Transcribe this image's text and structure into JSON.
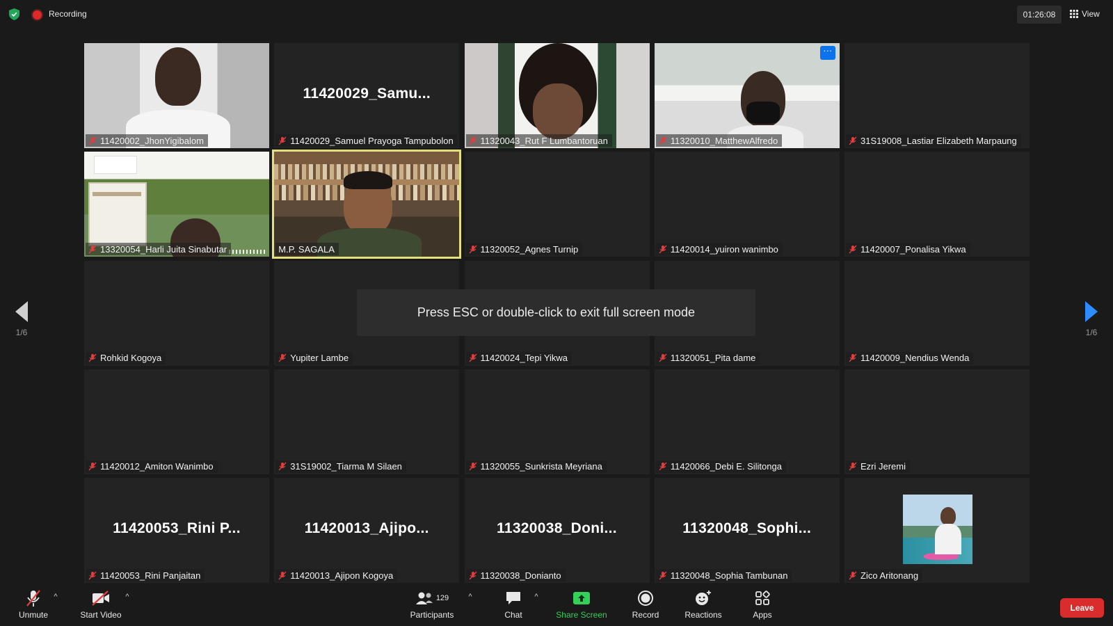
{
  "topbar": {
    "recording_label": "Recording",
    "timer": "01:26:08",
    "view_label": "View"
  },
  "colors": {
    "background": "#1a1a1a",
    "tile": "#232323",
    "active_speaker_border": "#e4e07a",
    "share_green": "#34d058",
    "leave_red": "#d92d2d",
    "accent_blue": "#2d8cff"
  },
  "tiles": [
    {
      "name": "11420002_JhonYigibalom",
      "big": "",
      "video": true
    },
    {
      "name": "11420029_Samuel Prayoga Tampubolon",
      "big": "11420029_Samu...",
      "video": false
    },
    {
      "name": "11320043_Rut F Lumbantoruan",
      "big": "",
      "video": true
    },
    {
      "name": "11320010_MatthewAlfredo",
      "big": "",
      "video": true,
      "more_button": "···"
    },
    {
      "name": "31S19008_Lastiar Elizabeth Marpaung",
      "big": "",
      "video": false
    },
    {
      "name": "13320054_Harli Juita Sinabutar",
      "big": "",
      "video": true
    },
    {
      "name": "M.P. SAGALA",
      "big": "",
      "video": true,
      "active_speaker": true
    },
    {
      "name": "11320052_Agnes Turnip",
      "big": "",
      "video": false
    },
    {
      "name": "11420014_yuiron wanimbo",
      "big": "",
      "video": false
    },
    {
      "name": "11420007_Ponalisa Yikwa",
      "big": "",
      "video": false
    },
    {
      "name": "Rohkid Kogoya",
      "big": "",
      "video": false
    },
    {
      "name": "Yupiter Lambe",
      "big": "",
      "video": false
    },
    {
      "name": "11420024_Tepi Yikwa",
      "big": "",
      "video": false
    },
    {
      "name": "11320051_Pita dame",
      "big": "",
      "video": false
    },
    {
      "name": "11420009_Nendius Wenda",
      "big": "",
      "video": false
    },
    {
      "name": "11420012_Amiton Wanimbo",
      "big": "",
      "video": false
    },
    {
      "name": "31S19002_Tiarma M Silaen",
      "big": "",
      "video": false
    },
    {
      "name": "11320055_Sunkrista Meyriana",
      "big": "",
      "video": false
    },
    {
      "name": "11420066_Debi E. Silitonga",
      "big": "",
      "video": false
    },
    {
      "name": "Ezri Jeremi",
      "big": "",
      "video": false
    },
    {
      "name": "11420053_Rini Panjaitan",
      "big": "11420053_Rini  P...",
      "video": false
    },
    {
      "name": "11420013_Ajipon Kogoya",
      "big": "11420013_Ajipo...",
      "video": false
    },
    {
      "name": "11320038_Donianto",
      "big": "11320038_Doni...",
      "video": false
    },
    {
      "name": "11320048_Sophia Tambunan",
      "big": "11320048_Sophi...",
      "video": false
    },
    {
      "name": "Zico Aritonang",
      "big": "",
      "video": false,
      "avatar": true
    }
  ],
  "toast": "Press ESC or double-click to exit full screen mode",
  "pager": {
    "left": "1/6",
    "right": "1/6"
  },
  "toolbar": {
    "unmute": "Unmute",
    "start_video": "Start Video",
    "participants": "Participants",
    "participants_count": "129",
    "chat": "Chat",
    "share_screen": "Share Screen",
    "record": "Record",
    "reactions": "Reactions",
    "apps": "Apps",
    "leave": "Leave"
  }
}
